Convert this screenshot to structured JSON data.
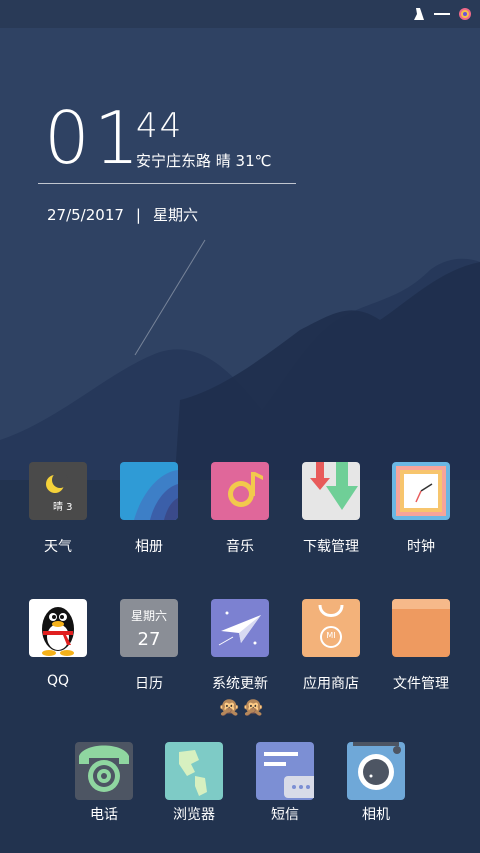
{
  "clock": {
    "hour": "01",
    "minute": "44",
    "location_weather": "安宁庄东路 晴 31℃",
    "date": "27/5/2017",
    "separator": "|",
    "weekday": "星期六"
  },
  "apps_row1": [
    {
      "label": "天气",
      "icon": "weather-icon",
      "icon_text": "晴 3"
    },
    {
      "label": "相册",
      "icon": "gallery-icon"
    },
    {
      "label": "音乐",
      "icon": "music-icon"
    },
    {
      "label": "下载管理",
      "icon": "download-icon"
    },
    {
      "label": "时钟",
      "icon": "clock-icon"
    }
  ],
  "apps_row2": [
    {
      "label": "QQ",
      "icon": "qq-penguin-icon"
    },
    {
      "label": "日历",
      "icon": "calendar-icon",
      "icon_weekday": "星期六",
      "icon_day": "27"
    },
    {
      "label": "系统更新",
      "icon": "paper-plane-icon"
    },
    {
      "label": "应用商店",
      "icon": "mi-store-bag-icon",
      "icon_text": "MI"
    },
    {
      "label": "文件管理",
      "icon": "folder-icon"
    }
  ],
  "page_indicator": "🙊🙊",
  "dock": [
    {
      "label": "电话",
      "icon": "phone-icon"
    },
    {
      "label": "浏览器",
      "icon": "browser-map-icon"
    },
    {
      "label": "短信",
      "icon": "message-icon"
    },
    {
      "label": "相机",
      "icon": "camera-icon"
    }
  ],
  "colors": {
    "sky": "#2c3e5c",
    "mountain_front": "#223452",
    "mountain_back": "#34496b"
  }
}
